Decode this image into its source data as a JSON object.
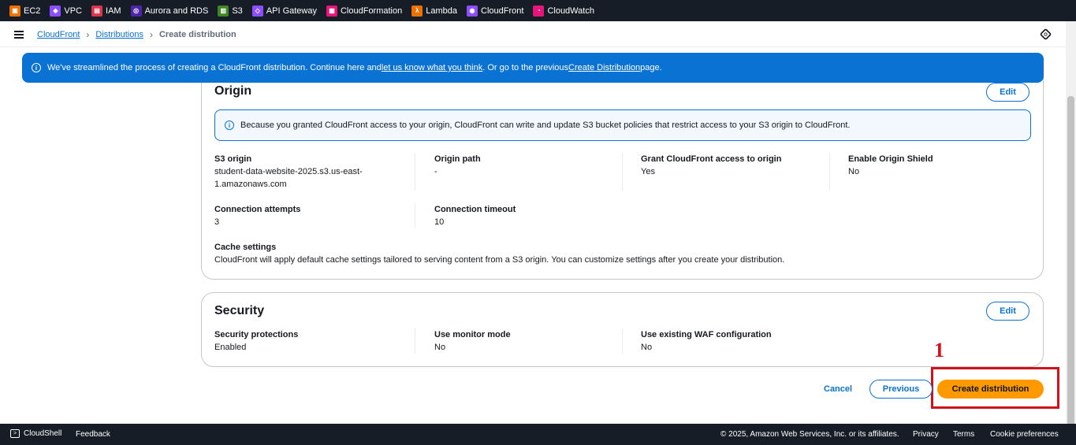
{
  "services_bar": {
    "items": [
      {
        "label": "EC2",
        "color": "#ed7100",
        "glyph": "▣"
      },
      {
        "label": "VPC",
        "color": "#8c4fff",
        "glyph": "◈"
      },
      {
        "label": "IAM",
        "color": "#dd344c",
        "glyph": "▤"
      },
      {
        "label": "Aurora and RDS",
        "color": "#4d27a8",
        "glyph": "◎"
      },
      {
        "label": "S3",
        "color": "#3f8624",
        "glyph": "▥"
      },
      {
        "label": "API Gateway",
        "color": "#8c4fff",
        "glyph": "◇"
      },
      {
        "label": "CloudFormation",
        "color": "#e7157b",
        "glyph": "▦"
      },
      {
        "label": "Lambda",
        "color": "#ed7100",
        "glyph": "λ"
      },
      {
        "label": "CloudFront",
        "color": "#8c4fff",
        "glyph": "◉"
      },
      {
        "label": "CloudWatch",
        "color": "#e7157b",
        "glyph": "◔"
      }
    ]
  },
  "breadcrumb": {
    "items": [
      "CloudFront",
      "Distributions"
    ],
    "current": "Create distribution",
    "separator": "›"
  },
  "flash": {
    "text_before": "We've streamlined the process of creating a CloudFront distribution. Continue here and ",
    "link1": "let us know what you think",
    "text_middle": ". Or go to the previous ",
    "link2": "Create Distribution",
    "text_after": " page."
  },
  "origin": {
    "title": "Origin",
    "edit_label": "Edit",
    "info_text": "Because you granted CloudFront access to your origin, CloudFront can write and update S3 bucket policies that restrict access to your S3 origin to CloudFront.",
    "s3_origin_label": "S3 origin",
    "s3_origin_value_line1": "student-data-website-2025.s3.us-east-",
    "s3_origin_value_line2": "1.amazonaws.com",
    "origin_path_label": "Origin path",
    "origin_path_value": "-",
    "grant_access_label": "Grant CloudFront access to origin",
    "grant_access_value": "Yes",
    "origin_shield_label": "Enable Origin Shield",
    "origin_shield_value": "No",
    "conn_attempts_label": "Connection attempts",
    "conn_attempts_value": "3",
    "conn_timeout_label": "Connection timeout",
    "conn_timeout_value": "10",
    "cache_label": "Cache settings",
    "cache_value": "CloudFront will apply default cache settings tailored to serving content from a S3 origin. You can customize settings after you create your distribution."
  },
  "security": {
    "title": "Security",
    "edit_label": "Edit",
    "protections_label": "Security protections",
    "protections_value": "Enabled",
    "monitor_label": "Use monitor mode",
    "monitor_value": "No",
    "waf_label": "Use existing WAF configuration",
    "waf_value": "No"
  },
  "actions": {
    "cancel": "Cancel",
    "previous": "Previous",
    "create": "Create distribution",
    "step_marker": "1"
  },
  "footer": {
    "cloudshell": "CloudShell",
    "feedback": "Feedback",
    "copyright": "© 2025, Amazon Web Services, Inc. or its affiliates.",
    "privacy": "Privacy",
    "terms": "Terms",
    "cookies": "Cookie preferences"
  },
  "colors": {
    "accent": "#0972d3",
    "primary_button": "#ff9900",
    "nav_bg": "#161d26",
    "annotation": "#d0121a"
  }
}
